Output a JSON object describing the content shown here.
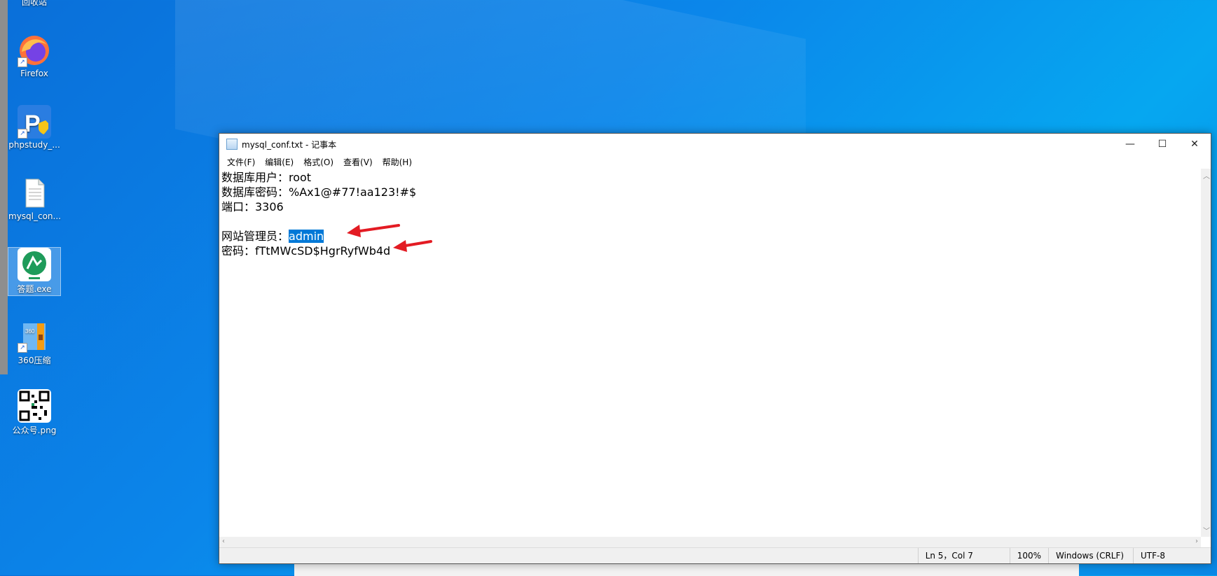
{
  "desktop": {
    "icons": [
      {
        "label": "回收站",
        "icon": "recycle-bin-icon"
      },
      {
        "label": "Firefox",
        "icon": "firefox-icon"
      },
      {
        "label": "phpstudy_...",
        "icon": "phpstudy-icon"
      },
      {
        "label": "mysql_con...",
        "icon": "text-file-icon"
      },
      {
        "label": "答题.exe",
        "icon": "exam-app-icon"
      },
      {
        "label": "360压缩",
        "icon": "zip-archive-icon"
      },
      {
        "label": "公众号.png",
        "icon": "qr-code-icon"
      }
    ]
  },
  "window": {
    "title": "mysql_conf.txt - 记事本",
    "controls": {
      "minimize": "—",
      "maximize": "☐",
      "close": "✕"
    },
    "menu": [
      "文件(F)",
      "编辑(E)",
      "格式(O)",
      "查看(V)",
      "帮助(H)"
    ],
    "content": {
      "line1": "数据库用户：root",
      "line2": "数据库密码：%Ax1@#77!aa123!#$",
      "line3": "端口：3306",
      "line4": "",
      "line5_prefix": "网站管理员：",
      "line5_selected": "admin",
      "line6": "密码：fTtMWcSD$HgrRyfWb4d"
    },
    "status": {
      "position": "Ln 5，Col 7",
      "zoom": "100%",
      "line_ending": "Windows (CRLF)",
      "encoding": "UTF-8"
    }
  },
  "colors": {
    "annotation_arrow": "#e31b23",
    "selection": "#0078d7"
  }
}
